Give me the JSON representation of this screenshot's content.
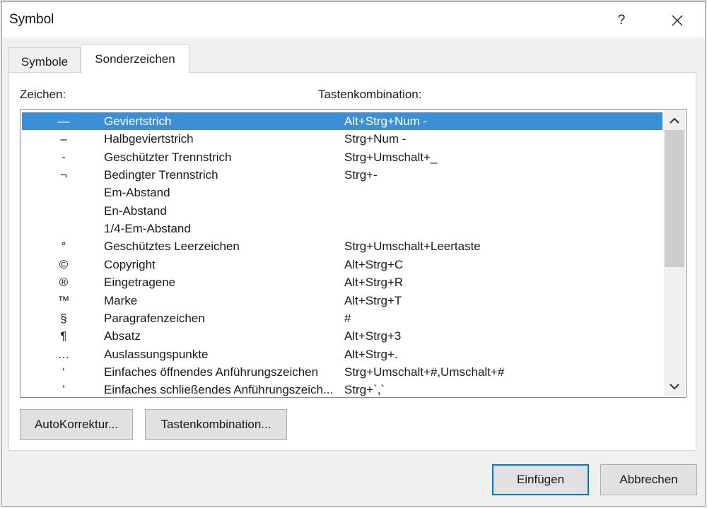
{
  "window": {
    "title": "Symbol",
    "help_label": "?"
  },
  "tabs": [
    {
      "label": "Symbole",
      "active": false
    },
    {
      "label": "Sonderzeichen",
      "active": true
    }
  ],
  "columns": {
    "char_header": "Zeichen:",
    "shortcut_header": "Tastenkombination:"
  },
  "rows": [
    {
      "symbol": "—",
      "name": "Geviertstrich",
      "shortcut": "Alt+Strg+Num -",
      "selected": true
    },
    {
      "symbol": "–",
      "name": "Halbgeviertstrich",
      "shortcut": "Strg+Num -"
    },
    {
      "symbol": "-",
      "name": "Geschützter Trennstrich",
      "shortcut": "Strg+Umschalt+_"
    },
    {
      "symbol": "¬",
      "name": "Bedingter Trennstrich",
      "shortcut": "Strg+-"
    },
    {
      "symbol": "",
      "name": "Em-Abstand",
      "shortcut": ""
    },
    {
      "symbol": "",
      "name": "En-Abstand",
      "shortcut": ""
    },
    {
      "symbol": "",
      "name": "1/4-Em-Abstand",
      "shortcut": ""
    },
    {
      "symbol": "°",
      "name": "Geschütztes Leerzeichen",
      "shortcut": "Strg+Umschalt+Leertaste"
    },
    {
      "symbol": "©",
      "name": "Copyright",
      "shortcut": "Alt+Strg+C"
    },
    {
      "symbol": "®",
      "name": "Eingetragene",
      "shortcut": "Alt+Strg+R"
    },
    {
      "symbol": "™",
      "name": "Marke",
      "shortcut": "Alt+Strg+T"
    },
    {
      "symbol": "§",
      "name": "Paragrafenzeichen",
      "shortcut": "#"
    },
    {
      "symbol": "¶",
      "name": "Absatz",
      "shortcut": "Alt+Strg+3"
    },
    {
      "symbol": "…",
      "name": "Auslassungspunkte",
      "shortcut": "Alt+Strg+."
    },
    {
      "symbol": "‘",
      "name": "Einfaches öffnendes Anführungszeichen",
      "shortcut": "Strg+Umschalt+#,Umschalt+#"
    },
    {
      "symbol": "’",
      "name": "Einfaches schließendes Anführungszeich...",
      "shortcut": "Strg+`,`"
    }
  ],
  "buttons": {
    "autokorrektur": "AutoKorrektur...",
    "tastenkombination": "Tastenkombination...",
    "einfuegen": "Einfügen",
    "abbrechen": "Abbrechen"
  },
  "icons": {
    "close": "close-icon",
    "scroll_up": "chevron-up-icon",
    "scroll_down": "chevron-down-icon"
  },
  "colors": {
    "selection": "#3a8fd9",
    "default_button_border": "#0078d7"
  },
  "scroll": {
    "thumb_position": 0.0,
    "visible_fraction": 0.52
  }
}
